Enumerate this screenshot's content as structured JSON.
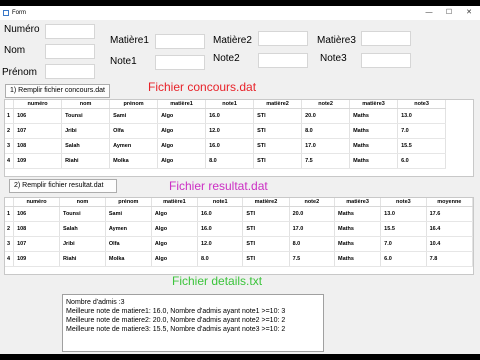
{
  "window": {
    "title": "Form",
    "controls": [
      "—",
      "☐",
      "✕"
    ]
  },
  "form": {
    "numero_label": "Numéro",
    "nom_label": "Nom",
    "prenom_label": "Prénom",
    "matiere1_label": "Matière1",
    "matiere2_label": "Matière2",
    "matiere3_label": "Matière3",
    "note1_label": "Note1",
    "note2_label": "Note2",
    "note3_label": "Note3"
  },
  "concours": {
    "button": "1) Remplir fichier concours.dat",
    "heading": "Fichier  concours.dat",
    "heading_color": "#e8232a",
    "columns": [
      "numéro",
      "nom",
      "prénom",
      "matière1",
      "note1",
      "matière2",
      "note2",
      "matière3",
      "note3"
    ],
    "rows": [
      {
        "n": "1",
        "cells": [
          "106",
          "Tounsi",
          "Sami",
          "Algo",
          "16.0",
          "STI",
          "20.0",
          "Maths",
          "13.0"
        ]
      },
      {
        "n": "2",
        "cells": [
          "107",
          "Jribi",
          "Olfa",
          "Algo",
          "12.0",
          "STI",
          "8.0",
          "Maths",
          "7.0"
        ]
      },
      {
        "n": "3",
        "cells": [
          "108",
          "Salah",
          "Aymen",
          "Algo",
          "16.0",
          "STI",
          "17.0",
          "Maths",
          "15.5"
        ]
      },
      {
        "n": "4",
        "cells": [
          "109",
          "Riahi",
          "Molka",
          "Algo",
          "8.0",
          "STI",
          "7.5",
          "Maths",
          "6.0"
        ]
      }
    ]
  },
  "resultat": {
    "button": "2) Remplir fichier resultat.dat",
    "heading": "Fichier resultat.dat",
    "heading_color": "#cc2fc4",
    "columns": [
      "numéro",
      "nom",
      "prénom",
      "matière1",
      "note1",
      "matière2",
      "note2",
      "matière3",
      "note3",
      "moyenne"
    ],
    "rows": [
      {
        "n": "1",
        "cells": [
          "106",
          "Tounsi",
          "Sami",
          "Algo",
          "16.0",
          "STI",
          "20.0",
          "Maths",
          "13.0",
          "17.6"
        ]
      },
      {
        "n": "2",
        "cells": [
          "108",
          "Salah",
          "Aymen",
          "Algo",
          "16.0",
          "STI",
          "17.0",
          "Maths",
          "15.5",
          "16.4"
        ]
      },
      {
        "n": "3",
        "cells": [
          "107",
          "Jribi",
          "Olfa",
          "Algo",
          "12.0",
          "STI",
          "8.0",
          "Maths",
          "7.0",
          "10.4"
        ]
      },
      {
        "n": "4",
        "cells": [
          "109",
          "Riahi",
          "Molka",
          "Algo",
          "8.0",
          "STI",
          "7.5",
          "Maths",
          "6.0",
          "7.8"
        ]
      }
    ]
  },
  "details": {
    "heading": "Fichier details.txt",
    "heading_color": "#3cc43c",
    "lines": [
      "Nombre d'admis :3",
      "Meilleure note de matiere1: 16.0, Nombre d'admis ayant note1 >=10: 3",
      "Meilleure note de matiere2: 20.0, Nombre d'admis ayant note2 >=10: 2",
      "Meilleure note de matiere3: 15.5, Nombre d'admis ayant note3 >=10: 2"
    ]
  }
}
